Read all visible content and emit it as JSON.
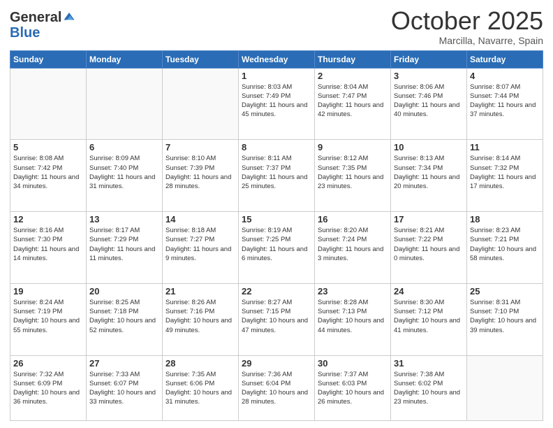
{
  "header": {
    "logo_general": "General",
    "logo_blue": "Blue",
    "month_title": "October 2025",
    "location": "Marcilla, Navarre, Spain"
  },
  "weekdays": [
    "Sunday",
    "Monday",
    "Tuesday",
    "Wednesday",
    "Thursday",
    "Friday",
    "Saturday"
  ],
  "weeks": [
    [
      {
        "day": "",
        "sunrise": "",
        "sunset": "",
        "daylight": ""
      },
      {
        "day": "",
        "sunrise": "",
        "sunset": "",
        "daylight": ""
      },
      {
        "day": "",
        "sunrise": "",
        "sunset": "",
        "daylight": ""
      },
      {
        "day": "1",
        "sunrise": "Sunrise: 8:03 AM",
        "sunset": "Sunset: 7:49 PM",
        "daylight": "Daylight: 11 hours and 45 minutes."
      },
      {
        "day": "2",
        "sunrise": "Sunrise: 8:04 AM",
        "sunset": "Sunset: 7:47 PM",
        "daylight": "Daylight: 11 hours and 42 minutes."
      },
      {
        "day": "3",
        "sunrise": "Sunrise: 8:06 AM",
        "sunset": "Sunset: 7:46 PM",
        "daylight": "Daylight: 11 hours and 40 minutes."
      },
      {
        "day": "4",
        "sunrise": "Sunrise: 8:07 AM",
        "sunset": "Sunset: 7:44 PM",
        "daylight": "Daylight: 11 hours and 37 minutes."
      }
    ],
    [
      {
        "day": "5",
        "sunrise": "Sunrise: 8:08 AM",
        "sunset": "Sunset: 7:42 PM",
        "daylight": "Daylight: 11 hours and 34 minutes."
      },
      {
        "day": "6",
        "sunrise": "Sunrise: 8:09 AM",
        "sunset": "Sunset: 7:40 PM",
        "daylight": "Daylight: 11 hours and 31 minutes."
      },
      {
        "day": "7",
        "sunrise": "Sunrise: 8:10 AM",
        "sunset": "Sunset: 7:39 PM",
        "daylight": "Daylight: 11 hours and 28 minutes."
      },
      {
        "day": "8",
        "sunrise": "Sunrise: 8:11 AM",
        "sunset": "Sunset: 7:37 PM",
        "daylight": "Daylight: 11 hours and 25 minutes."
      },
      {
        "day": "9",
        "sunrise": "Sunrise: 8:12 AM",
        "sunset": "Sunset: 7:35 PM",
        "daylight": "Daylight: 11 hours and 23 minutes."
      },
      {
        "day": "10",
        "sunrise": "Sunrise: 8:13 AM",
        "sunset": "Sunset: 7:34 PM",
        "daylight": "Daylight: 11 hours and 20 minutes."
      },
      {
        "day": "11",
        "sunrise": "Sunrise: 8:14 AM",
        "sunset": "Sunset: 7:32 PM",
        "daylight": "Daylight: 11 hours and 17 minutes."
      }
    ],
    [
      {
        "day": "12",
        "sunrise": "Sunrise: 8:16 AM",
        "sunset": "Sunset: 7:30 PM",
        "daylight": "Daylight: 11 hours and 14 minutes."
      },
      {
        "day": "13",
        "sunrise": "Sunrise: 8:17 AM",
        "sunset": "Sunset: 7:29 PM",
        "daylight": "Daylight: 11 hours and 11 minutes."
      },
      {
        "day": "14",
        "sunrise": "Sunrise: 8:18 AM",
        "sunset": "Sunset: 7:27 PM",
        "daylight": "Daylight: 11 hours and 9 minutes."
      },
      {
        "day": "15",
        "sunrise": "Sunrise: 8:19 AM",
        "sunset": "Sunset: 7:25 PM",
        "daylight": "Daylight: 11 hours and 6 minutes."
      },
      {
        "day": "16",
        "sunrise": "Sunrise: 8:20 AM",
        "sunset": "Sunset: 7:24 PM",
        "daylight": "Daylight: 11 hours and 3 minutes."
      },
      {
        "day": "17",
        "sunrise": "Sunrise: 8:21 AM",
        "sunset": "Sunset: 7:22 PM",
        "daylight": "Daylight: 11 hours and 0 minutes."
      },
      {
        "day": "18",
        "sunrise": "Sunrise: 8:23 AM",
        "sunset": "Sunset: 7:21 PM",
        "daylight": "Daylight: 10 hours and 58 minutes."
      }
    ],
    [
      {
        "day": "19",
        "sunrise": "Sunrise: 8:24 AM",
        "sunset": "Sunset: 7:19 PM",
        "daylight": "Daylight: 10 hours and 55 minutes."
      },
      {
        "day": "20",
        "sunrise": "Sunrise: 8:25 AM",
        "sunset": "Sunset: 7:18 PM",
        "daylight": "Daylight: 10 hours and 52 minutes."
      },
      {
        "day": "21",
        "sunrise": "Sunrise: 8:26 AM",
        "sunset": "Sunset: 7:16 PM",
        "daylight": "Daylight: 10 hours and 49 minutes."
      },
      {
        "day": "22",
        "sunrise": "Sunrise: 8:27 AM",
        "sunset": "Sunset: 7:15 PM",
        "daylight": "Daylight: 10 hours and 47 minutes."
      },
      {
        "day": "23",
        "sunrise": "Sunrise: 8:28 AM",
        "sunset": "Sunset: 7:13 PM",
        "daylight": "Daylight: 10 hours and 44 minutes."
      },
      {
        "day": "24",
        "sunrise": "Sunrise: 8:30 AM",
        "sunset": "Sunset: 7:12 PM",
        "daylight": "Daylight: 10 hours and 41 minutes."
      },
      {
        "day": "25",
        "sunrise": "Sunrise: 8:31 AM",
        "sunset": "Sunset: 7:10 PM",
        "daylight": "Daylight: 10 hours and 39 minutes."
      }
    ],
    [
      {
        "day": "26",
        "sunrise": "Sunrise: 7:32 AM",
        "sunset": "Sunset: 6:09 PM",
        "daylight": "Daylight: 10 hours and 36 minutes."
      },
      {
        "day": "27",
        "sunrise": "Sunrise: 7:33 AM",
        "sunset": "Sunset: 6:07 PM",
        "daylight": "Daylight: 10 hours and 33 minutes."
      },
      {
        "day": "28",
        "sunrise": "Sunrise: 7:35 AM",
        "sunset": "Sunset: 6:06 PM",
        "daylight": "Daylight: 10 hours and 31 minutes."
      },
      {
        "day": "29",
        "sunrise": "Sunrise: 7:36 AM",
        "sunset": "Sunset: 6:04 PM",
        "daylight": "Daylight: 10 hours and 28 minutes."
      },
      {
        "day": "30",
        "sunrise": "Sunrise: 7:37 AM",
        "sunset": "Sunset: 6:03 PM",
        "daylight": "Daylight: 10 hours and 26 minutes."
      },
      {
        "day": "31",
        "sunrise": "Sunrise: 7:38 AM",
        "sunset": "Sunset: 6:02 PM",
        "daylight": "Daylight: 10 hours and 23 minutes."
      },
      {
        "day": "",
        "sunrise": "",
        "sunset": "",
        "daylight": ""
      }
    ]
  ]
}
